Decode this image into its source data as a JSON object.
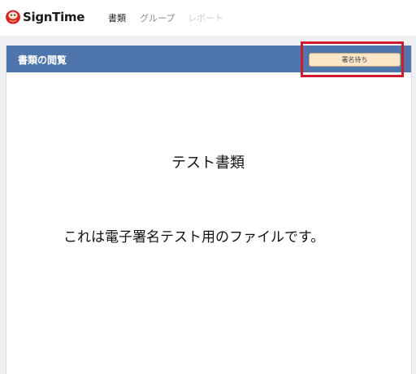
{
  "app": {
    "brand": "SignTime"
  },
  "nav": {
    "documents": "書類",
    "groups": "グループ",
    "reports": "レポート"
  },
  "panel": {
    "title": "書類の閲覧",
    "status_button": "署名待ち"
  },
  "document": {
    "title": "テスト書類",
    "body": "これは電子署名テスト用のファイルです。"
  },
  "colors": {
    "header_blue": "#4e76ad",
    "status_button_bg": "#fbe6c8",
    "highlight_red": "#d01a2e"
  }
}
